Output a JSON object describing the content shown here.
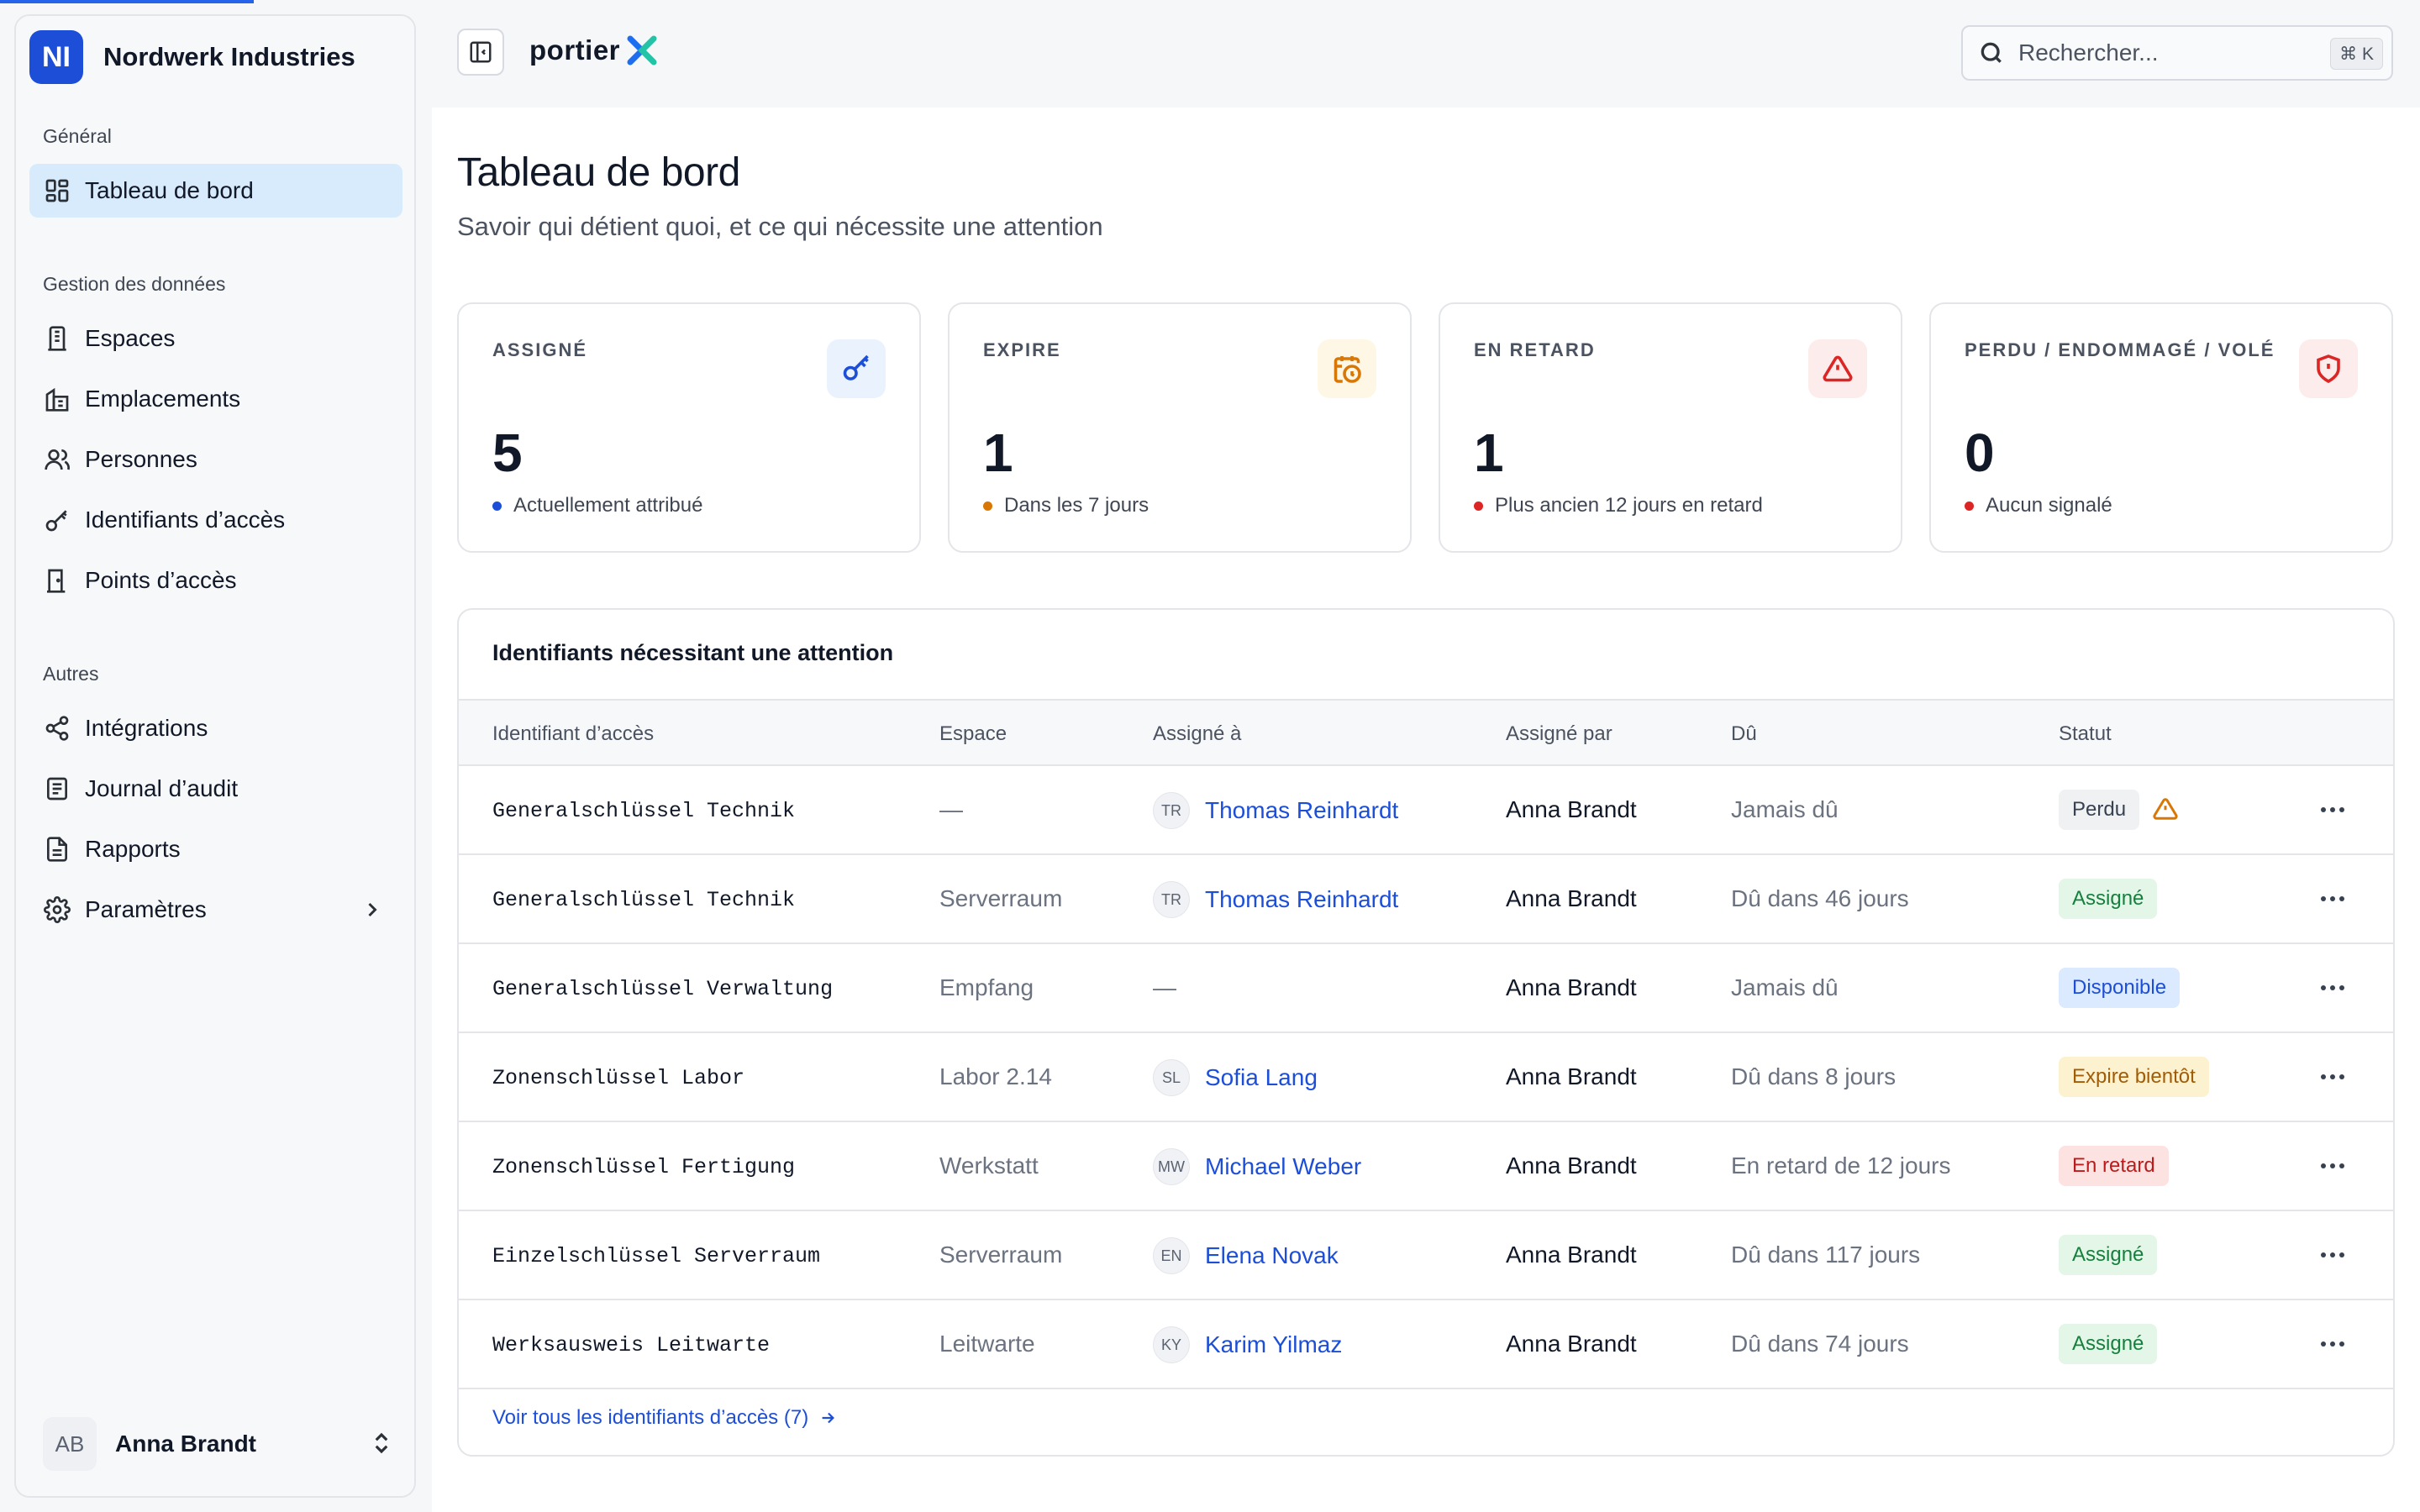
{
  "org": {
    "initials": "NI",
    "name": "Nordwerk Industries"
  },
  "sidebar": {
    "sections": [
      "Général",
      "Gestion des données",
      "Autres"
    ],
    "items": [
      {
        "label": "Tableau de bord",
        "icon": "dashboard-icon",
        "active": true
      },
      {
        "label": "Espaces",
        "icon": "building-icon"
      },
      {
        "label": "Emplacements",
        "icon": "buildings-icon"
      },
      {
        "label": "Personnes",
        "icon": "users-icon"
      },
      {
        "label": "Identifiants d’accès",
        "icon": "key-icon"
      },
      {
        "label": "Points d’accès",
        "icon": "door-icon"
      },
      {
        "label": "Intégrations",
        "icon": "share-icon"
      },
      {
        "label": "Journal d’audit",
        "icon": "log-icon"
      },
      {
        "label": "Rapports",
        "icon": "report-icon"
      },
      {
        "label": "Paramètres",
        "icon": "gear-icon"
      }
    ]
  },
  "user": {
    "initials": "AB",
    "name": "Anna Brandt"
  },
  "topbar": {
    "brand": "portier",
    "search_placeholder": "Rechercher...",
    "shortcut": "⌘ K"
  },
  "page": {
    "title": "Tableau de bord",
    "subtitle": "Savoir qui détient quoi, et ce qui nécessite une attention"
  },
  "stats": [
    {
      "label": "ASSIGNÉ",
      "value": "5",
      "note": "Actuellement attribué",
      "icon": "key-icon",
      "color": "#1d4ed8",
      "bg": "#eaf2fe",
      "dot": "#1d4ed8"
    },
    {
      "label": "EXPIRE",
      "value": "1",
      "note": "Dans les 7 jours",
      "icon": "calendar-clock-icon",
      "color": "#d97706",
      "bg": "#fff7e6",
      "dot": "#d97706"
    },
    {
      "label": "EN RETARD",
      "value": "1",
      "note": "Plus ancien 12 jours en retard",
      "icon": "alert-triangle-icon",
      "color": "#dc2626",
      "bg": "#fdecec",
      "dot": "#dc2626"
    },
    {
      "label": "PERDU / ENDOMMAGÉ / VOLÉ",
      "value": "0",
      "note": "Aucun signalé",
      "icon": "shield-alert-icon",
      "color": "#dc2626",
      "bg": "#fdecec",
      "dot": "#dc2626"
    }
  ],
  "table": {
    "title": "Identifiants nécessitant une attention",
    "columns": [
      "Identifiant d’accès",
      "Espace",
      "Assigné à",
      "Assigné par",
      "Dû",
      "Statut"
    ],
    "rows": [
      {
        "credential": "Generalschlüssel Technik",
        "space": "—",
        "initials": "TR",
        "assignee": "Thomas Reinhardt",
        "by": "Anna Brandt",
        "due": "Jamais dû",
        "status": "Perdu",
        "status_style": "neutral",
        "warning": true
      },
      {
        "credential": "Generalschlüssel Technik",
        "space": "Serverraum",
        "initials": "TR",
        "assignee": "Thomas Reinhardt",
        "by": "Anna Brandt",
        "due": "Dû dans 46 jours",
        "status": "Assigné",
        "status_style": "green"
      },
      {
        "credential": "Generalschlüssel Verwaltung",
        "space": "Empfang",
        "initials": "",
        "assignee": "—",
        "by": "Anna Brandt",
        "due": "Jamais dû",
        "status": "Disponible",
        "status_style": "blue"
      },
      {
        "credential": "Zonenschlüssel Labor",
        "space": "Labor 2.14",
        "initials": "SL",
        "assignee": "Sofia Lang",
        "by": "Anna Brandt",
        "due": "Dû dans 8 jours",
        "status": "Expire bientôt",
        "status_style": "amber"
      },
      {
        "credential": "Zonenschlüssel Fertigung",
        "space": "Werkstatt",
        "initials": "MW",
        "assignee": "Michael Weber",
        "by": "Anna Brandt",
        "due": "En retard de 12 jours",
        "status": "En retard",
        "status_style": "red"
      },
      {
        "credential": "Einzelschlüssel Serverraum",
        "space": "Serverraum",
        "initials": "EN",
        "assignee": "Elena Novak",
        "by": "Anna Brandt",
        "due": "Dû dans 117 jours",
        "status": "Assigné",
        "status_style": "green"
      },
      {
        "credential": "Werksausweis Leitwarte",
        "space": "Leitwarte",
        "initials": "KY",
        "assignee": "Karim Yilmaz",
        "by": "Anna Brandt",
        "due": "Dû dans 74 jours",
        "status": "Assigné",
        "status_style": "green"
      }
    ],
    "view_all": "Voir tous les identifiants d’accès (7)"
  },
  "status_colors": {
    "neutral": {
      "bg": "#f0f1f3",
      "fg": "#374151"
    },
    "green": {
      "bg": "#e3f6e8",
      "fg": "#15803d"
    },
    "blue": {
      "bg": "#dbeafe",
      "fg": "#1d4ed8"
    },
    "amber": {
      "bg": "#fdf2d0",
      "fg": "#a15c07"
    },
    "red": {
      "bg": "#fde2e2",
      "fg": "#b91c1c"
    }
  }
}
